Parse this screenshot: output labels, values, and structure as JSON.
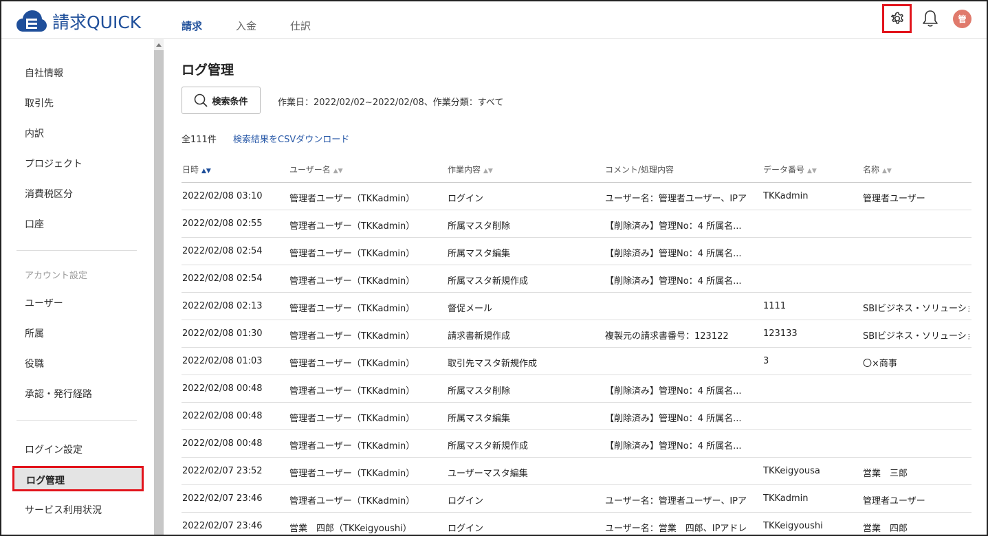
{
  "header": {
    "logo_text": "請求QUICK",
    "nav": [
      "請求",
      "入金",
      "仕訳"
    ],
    "avatar_text": "管",
    "icons": [
      "settings-gear-icon",
      "bell-icon"
    ],
    "accent_color": "#1f4f9a",
    "highlight_color": "#e2141c"
  },
  "sidebar": {
    "items_top": [
      "自社情報",
      "取引先",
      "内訳",
      "プロジェクト",
      "消費税区分",
      "口座"
    ],
    "section_account": "アカウント設定",
    "items_account": [
      "ユーザー",
      "所属",
      "役職",
      "承認・発行経路"
    ],
    "items_bottom": [
      "ログイン設定",
      "ログ管理",
      "サービス利用状況"
    ]
  },
  "main": {
    "title": "ログ管理",
    "search_label": "検索条件",
    "criteria": "作業日：2022/02/02~2022/02/08、作業分類：すべて",
    "count": "全111件",
    "csv_link": "検索結果をCSVダウンロード",
    "columns": [
      "日時",
      "ユーザー名",
      "作業内容",
      "コメント/処理内容",
      "データ番号",
      "名称"
    ],
    "rows": [
      [
        "2022/02/08 03:10",
        "管理者ユーザー（TKKadmin）",
        "ログイン",
        "ユーザー名：管理者ユーザー、IPア...",
        "TKKadmin",
        "管理者ユーザー"
      ],
      [
        "2022/02/08 02:55",
        "管理者ユーザー（TKKadmin）",
        "所属マスタ削除",
        "【削除済み】管理No：4 所属名...",
        "",
        ""
      ],
      [
        "2022/02/08 02:54",
        "管理者ユーザー（TKKadmin）",
        "所属マスタ編集",
        "【削除済み】管理No：4 所属名...",
        "",
        ""
      ],
      [
        "2022/02/08 02:54",
        "管理者ユーザー（TKKadmin）",
        "所属マスタ新規作成",
        "【削除済み】管理No：4 所属名...",
        "",
        ""
      ],
      [
        "2022/02/08 02:13",
        "管理者ユーザー（TKKadmin）",
        "督促メール",
        "",
        "1111",
        "SBIビジネス・ソリューション..."
      ],
      [
        "2022/02/08 01:30",
        "管理者ユーザー（TKKadmin）",
        "請求書新規作成",
        "複製元の請求書番号：123122",
        "123133",
        "SBIビジネス・ソリューション..."
      ],
      [
        "2022/02/08 01:03",
        "管理者ユーザー（TKKadmin）",
        "取引先マスタ新規作成",
        "",
        "3",
        "〇×商事"
      ],
      [
        "2022/02/08 00:48",
        "管理者ユーザー（TKKadmin）",
        "所属マスタ削除",
        "【削除済み】管理No：4 所属名...",
        "",
        ""
      ],
      [
        "2022/02/08 00:48",
        "管理者ユーザー（TKKadmin）",
        "所属マスタ編集",
        "【削除済み】管理No：4 所属名...",
        "",
        ""
      ],
      [
        "2022/02/08 00:48",
        "管理者ユーザー（TKKadmin）",
        "所属マスタ新規作成",
        "【削除済み】管理No：4 所属名...",
        "",
        ""
      ],
      [
        "2022/02/07 23:52",
        "管理者ユーザー（TKKadmin）",
        "ユーザーマスタ編集",
        "",
        "TKKeigyousa",
        "営業　三郎"
      ],
      [
        "2022/02/07 23:46",
        "管理者ユーザー（TKKadmin）",
        "ログイン",
        "ユーザー名：管理者ユーザー、IPア...",
        "TKKadmin",
        "管理者ユーザー"
      ],
      [
        "2022/02/07 23:46",
        "営業　四郎（TKKeigyoushi）",
        "ログイン",
        "ユーザー名：営業　四郎、IPアドレ...",
        "TKKeigyoushi",
        "営業　四郎"
      ]
    ]
  }
}
